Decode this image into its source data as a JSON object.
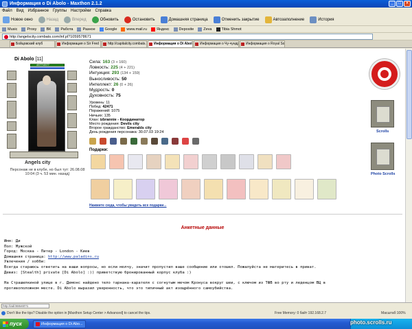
{
  "window": {
    "title": "Информация о Di Abolo - Maxthon 2.1.2"
  },
  "menu": [
    "Файл",
    "Вид",
    "Избранное",
    "Группы",
    "Настройки",
    "Справка"
  ],
  "toolbar": {
    "new_window": "Новое окно",
    "back": "Назад",
    "forward": "Вперед",
    "refresh": "Обновить",
    "stop": "Остановить",
    "home": "Домашняя страница",
    "undo_close": "Отменить закрытие",
    "autofill": "Автозаполнение",
    "history": "История"
  },
  "links": [
    "Music",
    "Proxy",
    "ВК",
    "Работа",
    "Разное",
    "Google",
    "www.mail.ru",
    "Яндекс",
    "Deposite",
    "Zeva",
    "Tibia Shmot"
  ],
  "address": {
    "url": "http://angelscity.combats.com/inf.pl?1059578671"
  },
  "tabs": [
    {
      "label": "Бойцовский клуб",
      "active": false
    },
    {
      "label": "Информация о Sir Fred",
      "active": false
    },
    {
      "label": "http://capitalcity.combats.com/z...",
      "active": false
    },
    {
      "label": "Информация о Di Abolo",
      "active": true
    },
    {
      "label": "Информация о Чу-чундрик",
      "active": false
    },
    {
      "label": "Информация о Royal Sorcerer",
      "active": false
    }
  ],
  "character": {
    "name": "Di Abolo",
    "level": "[11]",
    "hp": "4577/4577",
    "city": "Angels city",
    "note": "Персонаж не в клубе, но был тут: 26.08.08 10:04 (3 ч. 53 мин. назад)"
  },
  "stats": [
    {
      "label": "Сила:",
      "value": "163",
      "bonus": "(3 + 160)"
    },
    {
      "label": "Ловкость:",
      "value": "225",
      "bonus": "(4 + 221)"
    },
    {
      "label": "Интуиция:",
      "value": "293",
      "bonus": "(134 + 159)"
    },
    {
      "label": "Выносливость:",
      "value": "50",
      "bonus": ""
    },
    {
      "label": "Интеллект:",
      "value": "26",
      "bonus": "(0 + 26)"
    },
    {
      "label": "Мудрость:",
      "value": "0",
      "bonus": ""
    },
    {
      "label": "Духовность:",
      "value": "75",
      "bonus": ""
    }
  ],
  "info": [
    {
      "label": "Уровень:",
      "value": "11"
    },
    {
      "label": "Побед:",
      "value": "42471"
    },
    {
      "label": "Поражений:",
      "value": "1075"
    },
    {
      "label": "Ничьих:",
      "value": "135"
    },
    {
      "label": "Клан:",
      "value": "izbrannie - Координатор"
    },
    {
      "label": "Место рождения:",
      "value": "Devils city"
    },
    {
      "label": "Второе гражданство:",
      "value": "Emeralds city"
    },
    {
      "label": "День рождения персонажа:",
      "value": "30.07.03 19:24"
    }
  ],
  "gifts": {
    "label": "Подарки:",
    "more": "Нажмите сюда, чтобы увидеть все подарки..."
  },
  "right": {
    "scrolls": "Scrolls",
    "photo_scrolls": "Photo Scrolls"
  },
  "anketa": {
    "title": "Анкетные данные",
    "name": "Имя: Ди",
    "gender": "Пол: Мужской",
    "city": "Город: Москва - Питер - London - Киев",
    "home_label": "Домашняя страница: ",
    "home_url": "http://www.paladins.ru",
    "hobby": "Увлечения / хобби:",
    "hobby_text": "Всегда стараюсь ответить на ваши вопросы, но если молчу, значит пропустил ваше сообщение или отошел. Пожалуйста не материтесь в приват.",
    "motto": "Девиз: [Stealth] private [Di Abolo] :)) приветствую бронированный корпус клуба :)",
    "story1": "На Страшилкиной улице в г. Демонс найдено тело тарнана-карателя с согнутым мечом Кронуса вокруг шеи, с ключом из ТФВ во рту и леденцом ВЦ в",
    "story2": "противоположном месте. Di Abolo выразил уверенность, что это типичный акт изощрённого самоубийства."
  },
  "status": {
    "top": "http://ad/468x60?1",
    "tip": "Don't like the tips? Disable the option in [Maxthon Setup Center > Advanced] to cancel the tips.",
    "memory": "Free Memory: 0 байт  192.168.2.7",
    "zoom": "Масштаб:100%"
  },
  "taskbar": {
    "start": "пуск",
    "task": "Информация о Di Abo...",
    "clock": ""
  },
  "watermark": "photo.scrolls.ru"
}
